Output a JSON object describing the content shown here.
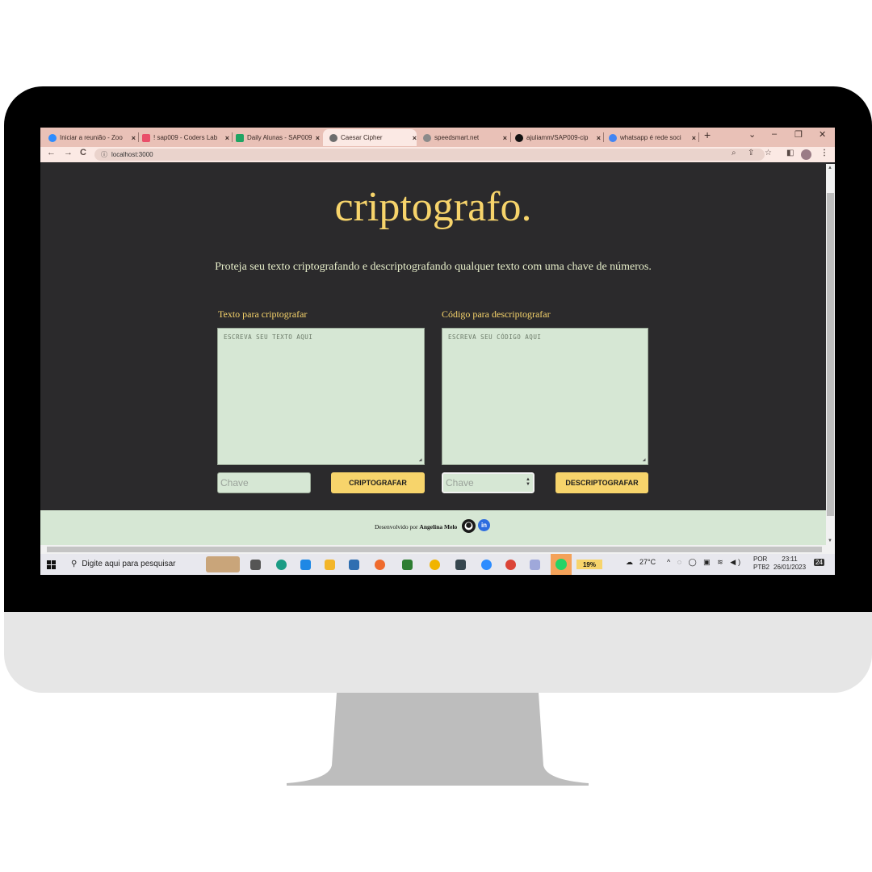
{
  "browser": {
    "tabs": [
      {
        "title": "Iniciar a reunião - Zoo",
        "color": "#2d8cff",
        "active": false
      },
      {
        "title": "! sap009 - Coders Lab",
        "color": "#e94f6a",
        "active": false
      },
      {
        "title": "Daily Alunas - SAP009",
        "color": "#1fa463",
        "active": false
      },
      {
        "title": "Caesar Cipher",
        "color": "#6c6c6c",
        "active": true
      },
      {
        "title": "speedsmart.net",
        "color": "#8a8a8a",
        "active": false
      },
      {
        "title": "ajuliamm/SAP009-cip",
        "color": "#111111",
        "active": false
      },
      {
        "title": "whatsapp é rede soci",
        "color": "#4285f4",
        "active": false
      }
    ],
    "close_glyph": "×",
    "new_tab_glyph": "+",
    "url": "localhost:3000",
    "window_controls": {
      "dropdown": "⌄",
      "minimize": "–",
      "restore": "❐",
      "close": "✕"
    }
  },
  "page": {
    "title": "criptografo.",
    "subtitle": "Proteja seu texto criptografando e descriptografando qualquer texto com uma chave de números.",
    "encrypt": {
      "label": "Texto para criptografar",
      "placeholder": "ESCREVA SEU TEXTO AQUI",
      "key_placeholder": "Chave",
      "button": "CRIPTOGRAFAR"
    },
    "decrypt": {
      "label": "Código para descriptografar",
      "placeholder": "ESCREVA SEU CÓDIGO AQUI",
      "key_placeholder": "Chave",
      "button": "DESCRIPTOGRAFAR"
    },
    "footer": {
      "prefix": "Desenvolvido por",
      "author": "Angelina Melo",
      "linkedin_glyph": "in"
    }
  },
  "taskbar": {
    "search_placeholder": "Digite aqui para pesquisar",
    "battery": "19%",
    "weather": "27°C",
    "language": "POR",
    "layout": "PTB2",
    "time": "23:11",
    "date": "26/01/2023",
    "notifications": "24"
  },
  "colors": {
    "accent": "#f7d46b",
    "panel": "#d6e7d4",
    "background": "#2b2a2c",
    "tabstrip": "#e9c1b7"
  }
}
